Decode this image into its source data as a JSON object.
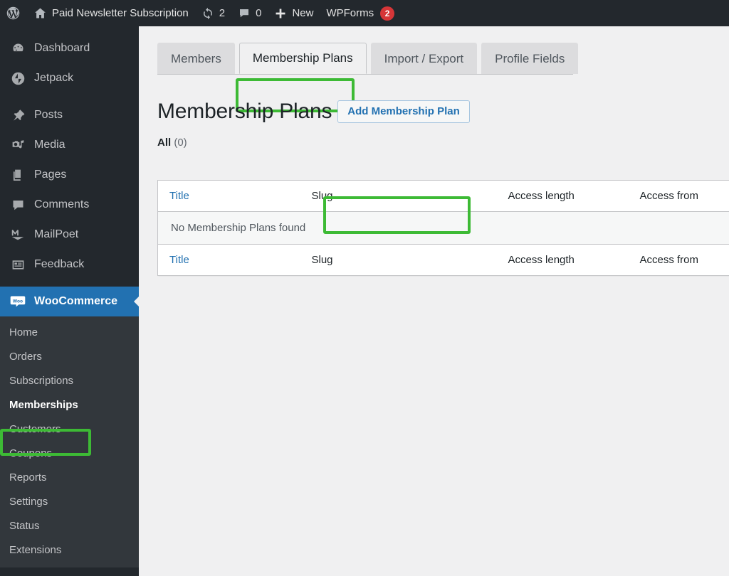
{
  "adminbar": {
    "wp_logo": "wordpress-logo-icon",
    "site_home_icon": "home-icon",
    "site_name": "Paid Newsletter Subscription",
    "updates_icon": "updates-icon",
    "updates_count": "2",
    "comments_icon": "comment-bubble-icon",
    "comments_count": "0",
    "new_icon": "plus-icon",
    "new_label": "New",
    "wpforms_label": "WPForms",
    "wpforms_badge": "2"
  },
  "sidebar": {
    "items": [
      {
        "label": "Dashboard",
        "icon": "dashboard-icon"
      },
      {
        "label": "Jetpack",
        "icon": "jetpack-icon"
      },
      {
        "label": "Posts",
        "icon": "pin-icon"
      },
      {
        "label": "Media",
        "icon": "media-icon"
      },
      {
        "label": "Pages",
        "icon": "pages-icon"
      },
      {
        "label": "Comments",
        "icon": "comment-bubble-icon"
      },
      {
        "label": "MailPoet",
        "icon": "mailpoet-icon"
      },
      {
        "label": "Feedback",
        "icon": "feedback-icon"
      },
      {
        "label": "WooCommerce",
        "icon": "woocommerce-icon"
      }
    ],
    "submenu": [
      {
        "label": "Home"
      },
      {
        "label": "Orders"
      },
      {
        "label": "Subscriptions"
      },
      {
        "label": "Memberships"
      },
      {
        "label": "Customers"
      },
      {
        "label": "Coupons"
      },
      {
        "label": "Reports"
      },
      {
        "label": "Settings"
      },
      {
        "label": "Status"
      },
      {
        "label": "Extensions"
      }
    ],
    "current_item": "WooCommerce",
    "highlighted_submenu": "Memberships"
  },
  "tabs": [
    {
      "label": "Members",
      "active": false
    },
    {
      "label": "Membership Plans",
      "active": true
    },
    {
      "label": "Import / Export",
      "active": false
    },
    {
      "label": "Profile Fields",
      "active": false
    }
  ],
  "page": {
    "title": "Membership Plans",
    "add_button": "Add Membership Plan",
    "filter_all_label": "All",
    "filter_all_count": "(0)"
  },
  "table": {
    "columns": [
      "Title",
      "Slug",
      "Access length",
      "Access from"
    ],
    "rows": [],
    "empty_message": "No Membership Plans found"
  },
  "colors": {
    "highlight_green": "#3dba35",
    "admin_blue": "#2271b1",
    "sidebar_bg": "#23282d",
    "submenu_bg": "#32373c",
    "badge_red": "#d63638",
    "content_bg": "#f0f0f1"
  }
}
